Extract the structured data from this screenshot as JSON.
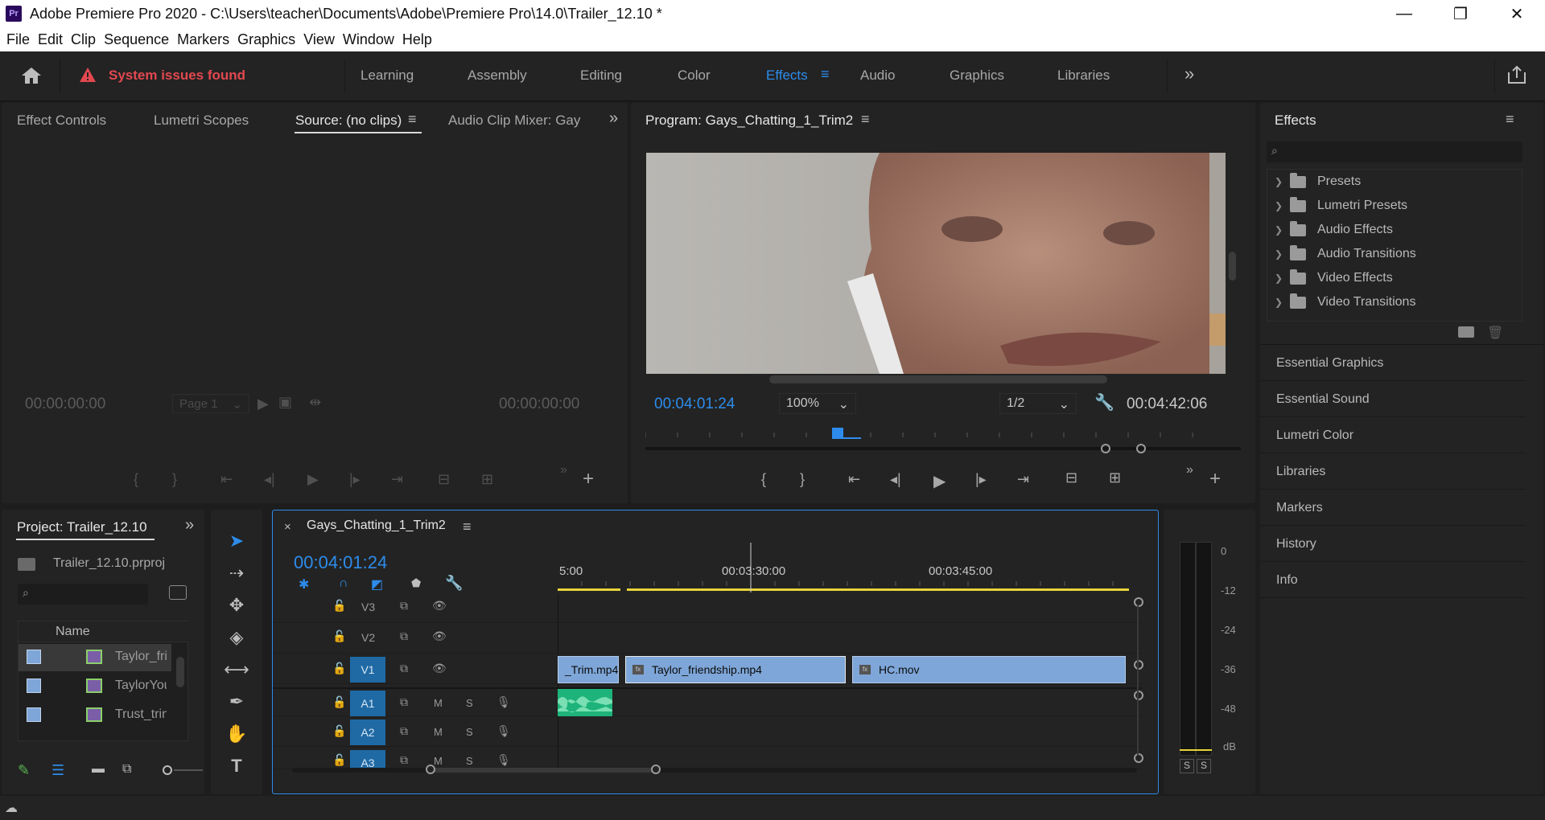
{
  "window": {
    "app_icon": "Pr",
    "title": "Adobe Premiere Pro 2020 - C:\\Users\\teacher\\Documents\\Adobe\\Premiere Pro\\14.0\\Trailer_12.10 *",
    "minimize": "—",
    "restore": "❐",
    "close": "✕"
  },
  "menu": [
    "File",
    "Edit",
    "Clip",
    "Sequence",
    "Markers",
    "Graphics",
    "View",
    "Window",
    "Help"
  ],
  "workspace": {
    "alert": "System issues found",
    "tabs": [
      "Learning",
      "Assembly",
      "Editing",
      "Color",
      "Effects",
      "Audio",
      "Graphics",
      "Libraries"
    ],
    "active_tab": "Effects",
    "more": "»"
  },
  "source_panel": {
    "tabs": [
      "Effect Controls",
      "Lumetri Scopes",
      "Source: (no clips)",
      "Audio Clip Mixer: Gays"
    ],
    "timecode_left": "00:00:00:00",
    "page_select": "Page 1",
    "timecode_right": "00:00:00:00"
  },
  "program_panel": {
    "title": "Program: Gays_Chatting_1_Trim2",
    "timecode": "00:04:01:24",
    "zoom": "100%",
    "resolution": "1/2",
    "duration": "00:04:42:06"
  },
  "effects_panel": {
    "title": "Effects",
    "tree": [
      "Presets",
      "Lumetri Presets",
      "Audio Effects",
      "Audio Transitions",
      "Video Effects",
      "Video Transitions"
    ],
    "side_panels": [
      "Essential Graphics",
      "Essential Sound",
      "Lumetri Color",
      "Libraries",
      "Markers",
      "History",
      "Info"
    ]
  },
  "project_panel": {
    "title": "Project: Trailer_12.10",
    "file": "Trailer_12.10.prproj",
    "column": "Name",
    "items": [
      "Taylor_fri",
      "TaylorYou",
      "Trust_trin"
    ]
  },
  "timeline": {
    "sequence": "Gays_Chatting_1_Trim2",
    "timecode": "00:04:01:24",
    "ruler": [
      "5:00",
      "00:03:30:00",
      "00:03:45:00"
    ],
    "video_tracks": [
      "V3",
      "V2",
      "V1"
    ],
    "audio_tracks": [
      "A1",
      "A2",
      "A3"
    ],
    "mute": "M",
    "solo": "S",
    "clips": [
      "_Trim.mp4",
      "Taylor_friendship.mp4",
      "HC.mov"
    ]
  },
  "audio_meter": {
    "scale": [
      "0",
      "-12",
      "-24",
      "-36",
      "-48",
      "dB"
    ],
    "solo_left": "S",
    "solo_right": "S"
  },
  "colors": {
    "accent": "#2d8ceb",
    "alert": "#e34850",
    "clip": "#7ea6d8",
    "audio_clip": "#1db37a",
    "track_target": "#1f6aa5"
  }
}
